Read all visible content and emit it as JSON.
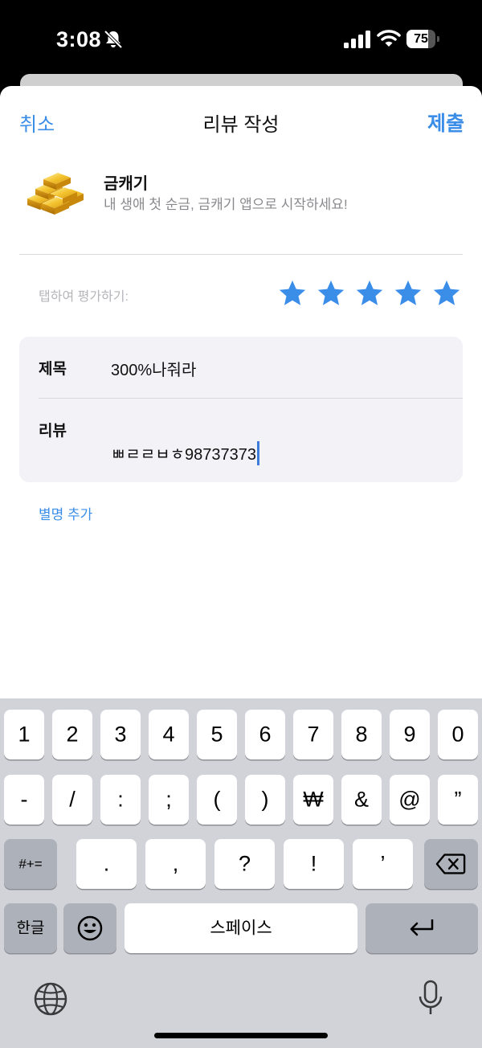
{
  "status_bar": {
    "time": "3:08",
    "battery": "75",
    "battery_level": 0.75
  },
  "nav": {
    "cancel": "취소",
    "title": "리뷰 작성",
    "submit": "제출"
  },
  "app": {
    "name": "금캐기",
    "subtitle": "내 생애 첫 순금, 금캐기 앱으로 시작하세요!",
    "icon": "gold-bars-icon"
  },
  "rating": {
    "label": "탭하여 평가하기:",
    "stars_total": 5,
    "stars_selected": 5,
    "star_color": "#3b8ee8"
  },
  "form": {
    "title_label": "제목",
    "title_value": "300%나줘라",
    "review_label": "리뷰",
    "review_value": "ㅃㄹㄹㅂㅎ98737373"
  },
  "nickname_link": "별명 추가",
  "keyboard": {
    "row1": [
      "1",
      "2",
      "3",
      "4",
      "5",
      "6",
      "7",
      "8",
      "9",
      "0"
    ],
    "row2": [
      "-",
      "/",
      ":",
      ";",
      "(",
      ")",
      "₩",
      "&",
      "@",
      "”"
    ],
    "row3": {
      "symbols": "#+=",
      "keys": [
        ".",
        ",",
        "?",
        "!",
        "’"
      ]
    },
    "row4": {
      "lang": "한글",
      "space": "스페이스"
    }
  },
  "colors": {
    "accent": "#3b8ee8",
    "keyboard_bg": "#d1d3d9"
  }
}
